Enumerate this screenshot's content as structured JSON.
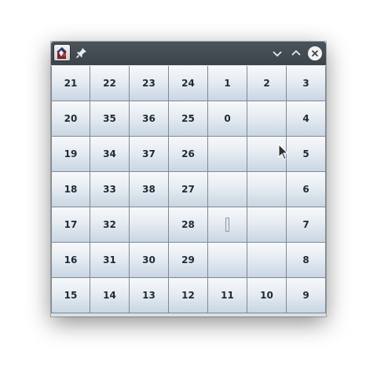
{
  "titlebar": {
    "app_icon": "app-icon",
    "pin_icon": "pin-icon",
    "buttons": [
      "minimize-icon",
      "maximize-icon",
      "close-icon"
    ]
  },
  "board": {
    "rows": [
      [
        "21",
        "22",
        "23",
        "24",
        "1",
        "2",
        "3"
      ],
      [
        "20",
        "35",
        "36",
        "25",
        "0",
        "",
        "4"
      ],
      [
        "19",
        "34",
        "37",
        "26",
        "",
        "",
        "5"
      ],
      [
        "18",
        "33",
        "38",
        "27",
        "",
        "",
        "6"
      ],
      [
        "17",
        "32",
        "",
        "28",
        "|",
        "",
        "7"
      ],
      [
        "16",
        "31",
        "30",
        "29",
        "",
        "",
        "8"
      ],
      [
        "15",
        "14",
        "13",
        "12",
        "11",
        "10",
        "9"
      ]
    ]
  },
  "colors": {
    "titlebar": "#434c54",
    "tile_top": "#f7f9fb",
    "tile_bottom": "#c9d6e3",
    "grid_line": "#7d8994",
    "text": "#1f2a36"
  }
}
